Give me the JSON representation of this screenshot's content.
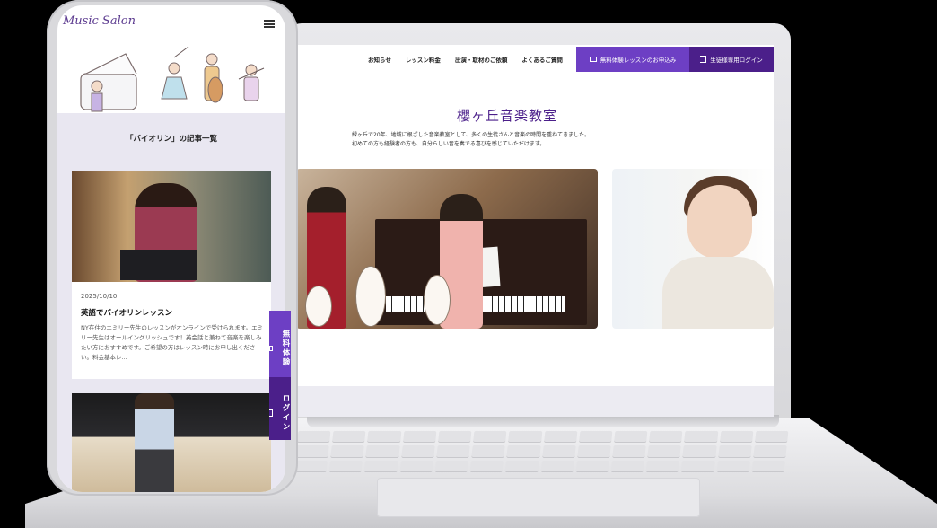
{
  "laptop_site": {
    "nav": {
      "links": [
        "お知らせ",
        "レッスン料金",
        "出演・取材のご依頼",
        "よくあるご質問"
      ],
      "trial_button": "無料体験レッスンのお申込み",
      "login_button": "生徒様専用ログイン"
    },
    "title": "櫻ヶ丘音楽教室",
    "description_line1": "緑ヶ丘で20年、地域に根ざした音楽教室として、多くの生徒さんと音楽の時間を重ねてきました。",
    "description_line2": "初めての方も経験者の方も、自分らしい音を奏でる喜びを感じていただけます。"
  },
  "phone_site": {
    "logo": "Music Salon",
    "heading": "「バイオリン」の記事一覧",
    "article": {
      "date": "2025/10/10",
      "title": "英語でバイオリンレッスン",
      "excerpt": "NY在住のエミリー先生のレッスンがオンラインで受けられます。エミリー先生はオールイングリッシュです！英会話と兼ねて音楽を楽しみたい方におすすめです。ご希望の方はレッスン時にお申し出ください。料金基本レ..."
    },
    "side_tabs": {
      "trial": "無料体験",
      "login": "ログイン"
    }
  },
  "colors": {
    "accent": "#6d3fc4",
    "accent_dark": "#4b1f8a",
    "title_purple": "#4b1f8a",
    "panel_lavender": "#e9e7f1"
  },
  "icons": [
    "menu-icon",
    "mail-icon",
    "login-icon"
  ]
}
